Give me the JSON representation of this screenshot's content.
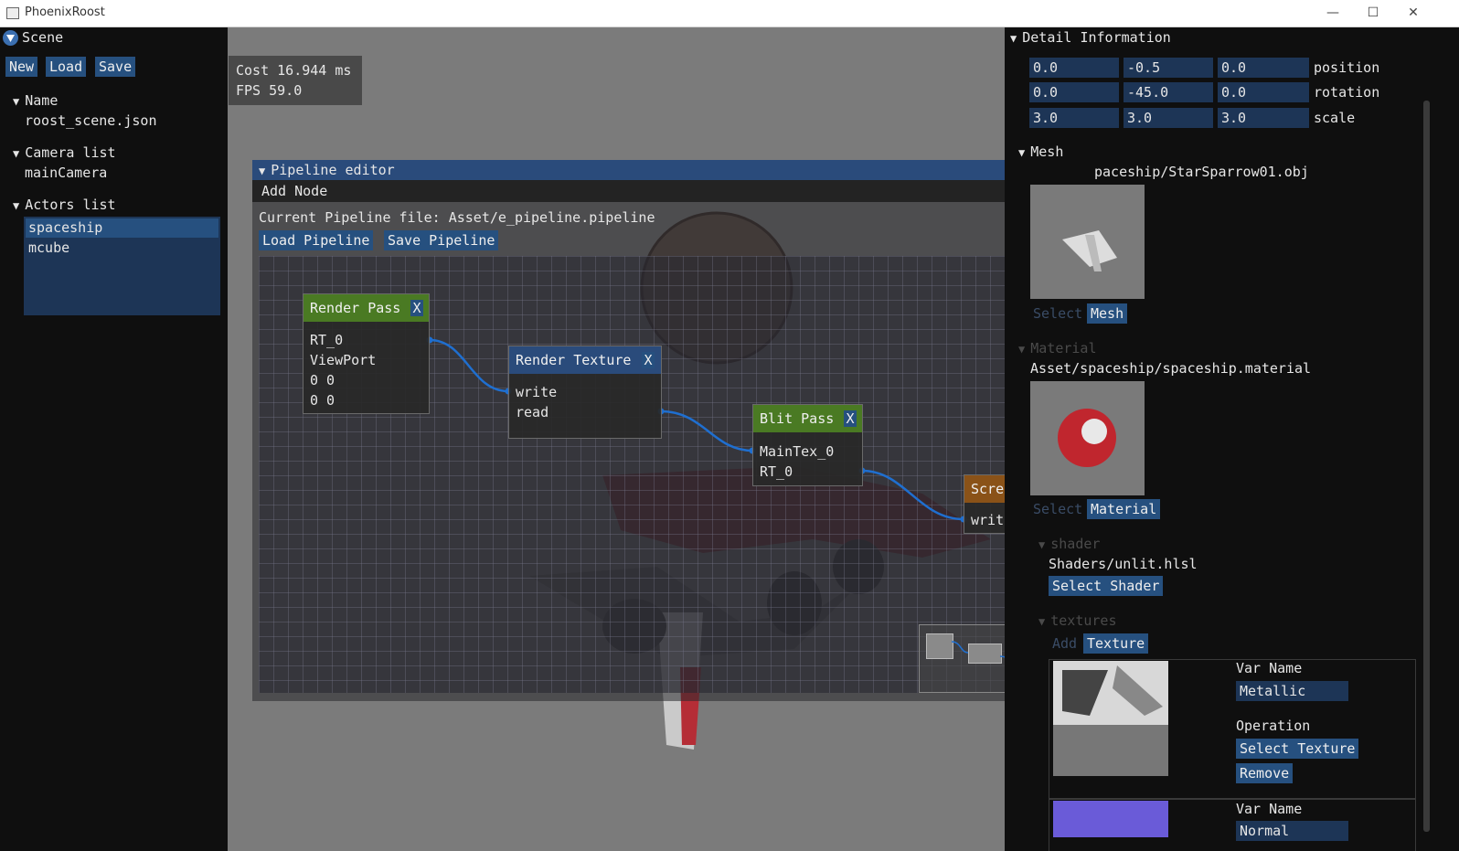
{
  "window": {
    "title": "PhoenixRoost",
    "minimize": "—",
    "maximize": "☐",
    "close": "✕"
  },
  "scene": {
    "title": "Scene",
    "buttons": {
      "new": "New",
      "load": "Load",
      "save": "Save"
    },
    "name_section": "Name",
    "name_value": "roost_scene.json",
    "camera_section": "Camera list",
    "camera_item": "mainCamera",
    "actors_section": "Actors list",
    "actors": [
      "spaceship",
      "mcube"
    ]
  },
  "stats": {
    "cost": "Cost 16.944 ms",
    "fps": "FPS  59.0"
  },
  "pipeline": {
    "title": "Pipeline editor",
    "menu_add": "Add Node",
    "current_file": "Current Pipeline file: Asset/e_pipeline.pipeline",
    "load_btn": "Load Pipeline",
    "save_btn": "Save Pipeline",
    "nodes": {
      "render_pass": {
        "title": "Render Pass",
        "close": "X",
        "rows": [
          "RT_0",
          "ViewPort",
          "0 0",
          "0 0"
        ]
      },
      "render_texture": {
        "title": "Render Texture",
        "close": "X",
        "rows": [
          "write",
          "read"
        ]
      },
      "blit_pass": {
        "title": "Blit Pass",
        "close": "X",
        "rows": [
          "MainTex_0",
          "RT_0"
        ]
      },
      "screen": {
        "title": "Screen",
        "rows": [
          "write"
        ]
      }
    }
  },
  "detail": {
    "title": "Detail Information",
    "transform": {
      "position": [
        "0.0",
        "-0.5",
        "0.0"
      ],
      "position_label": "position",
      "rotation": [
        "0.0",
        "-45.0",
        "0.0"
      ],
      "rotation_label": "rotation",
      "scale": [
        "3.0",
        "3.0",
        "3.0"
      ],
      "scale_label": "scale"
    },
    "mesh_section": "Mesh",
    "mesh_path": "paceship/StarSparrow01.obj",
    "select_mesh": "Mesh",
    "select_mesh_faded": "Select",
    "material_section": "Material",
    "material_path": "Asset/spaceship/spaceship.material",
    "select_material": "Material",
    "select_material_faded": "Select",
    "shader_section": "shader",
    "shader_path": "Shaders/unlit.hlsl",
    "select_shader": "Select Shader",
    "textures_section": "textures",
    "add_texture": "Texture",
    "add_texture_faded": "Add",
    "texture_rows": [
      {
        "var_name_label": "Var Name",
        "var_name": "Metallic",
        "operation_label": "Operation",
        "select_btn": "Select Texture",
        "remove_btn": "Remove"
      },
      {
        "var_name_label": "Var Name",
        "var_name": "Normal"
      }
    ]
  },
  "colors": {
    "button": "#26507f",
    "header": "#2a4b7b",
    "node_green": "#4a7a23",
    "node_blue": "#2a4b7b",
    "node_orange": "#8a5218",
    "wire": "#1f6fd0"
  }
}
